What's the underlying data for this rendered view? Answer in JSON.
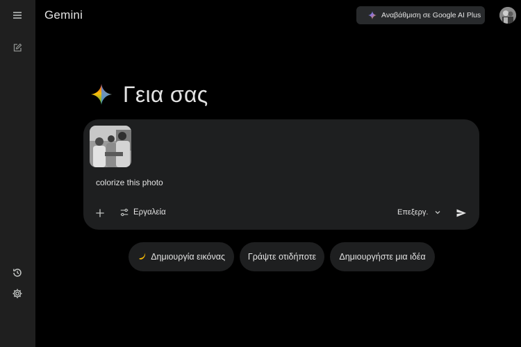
{
  "app": {
    "brand": "Gemini"
  },
  "sidebar": {
    "menu_icon": "menu-icon",
    "new_chat_icon": "edit-icon",
    "activity_icon": "history-icon",
    "settings_icon": "gear-icon"
  },
  "header": {
    "upgrade_label": "Αναβάθμιση σε Google AI Plus",
    "avatar": "user-avatar"
  },
  "greeting": {
    "text": "Γεια σας"
  },
  "composer": {
    "attachment": "uploaded-photo",
    "prompt_text": "colorize this photo",
    "tools_label": "Εργαλεία",
    "model_label": "Επεξεργ."
  },
  "chips": [
    {
      "icon": "banana-icon",
      "label": "Δημιουργία εικόνας"
    },
    {
      "label": "Γράψτε οτιδήποτε"
    },
    {
      "label": "Δημιουργήστε μια ιδέα"
    }
  ],
  "colors": {
    "background": "#000000",
    "sidebar": "#1f1f1f",
    "surface": "#1e1f20",
    "upgrade_button": "#282a2c",
    "text": "#e3e3e3"
  }
}
